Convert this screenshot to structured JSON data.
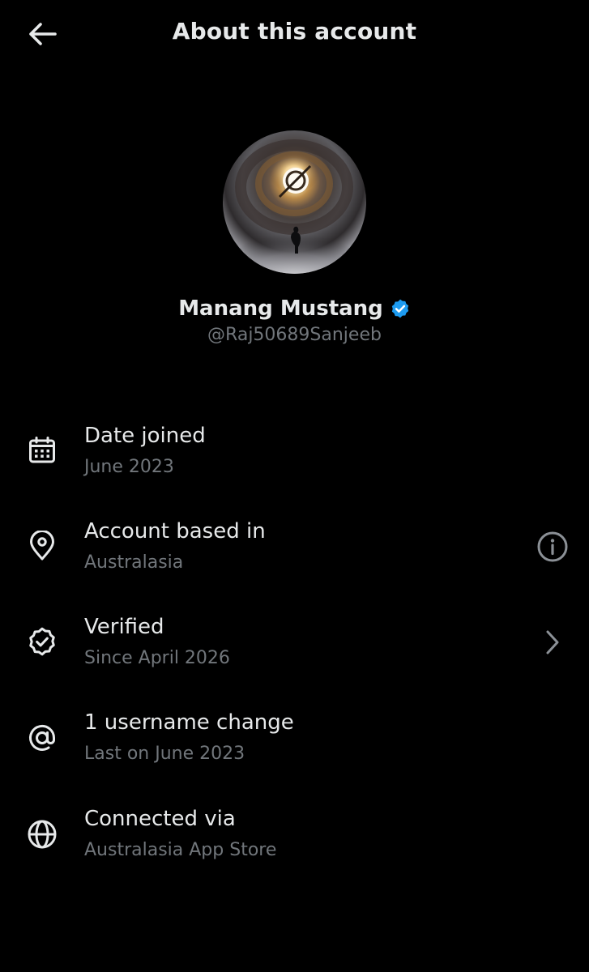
{
  "header": {
    "title": "About this account",
    "back_icon": "arrow-left-icon"
  },
  "profile": {
    "name": "Manang Mustang",
    "handle": "@Raj50689Sanjeeb",
    "verified_badge_color": "#1d9bf0"
  },
  "rows": [
    {
      "icon": "calendar-icon",
      "title": "Date joined",
      "subtitle": "June 2023"
    },
    {
      "icon": "location-pin-icon",
      "title": "Account based in",
      "subtitle": "Australasia",
      "right_icon": "info-icon"
    },
    {
      "icon": "verified-check-icon",
      "title": "Verified",
      "subtitle": "Since April 2026",
      "right_icon": "chevron-right-icon"
    },
    {
      "icon": "at-sign-icon",
      "title": "1 username change",
      "subtitle": "Last on June 2023"
    },
    {
      "icon": "globe-icon",
      "title": "Connected via",
      "subtitle": "Australasia App Store"
    }
  ],
  "colors": {
    "background": "#000000",
    "primary_text": "#e7e9ea",
    "secondary_text": "#71767b",
    "accent": "#1d9bf0"
  }
}
